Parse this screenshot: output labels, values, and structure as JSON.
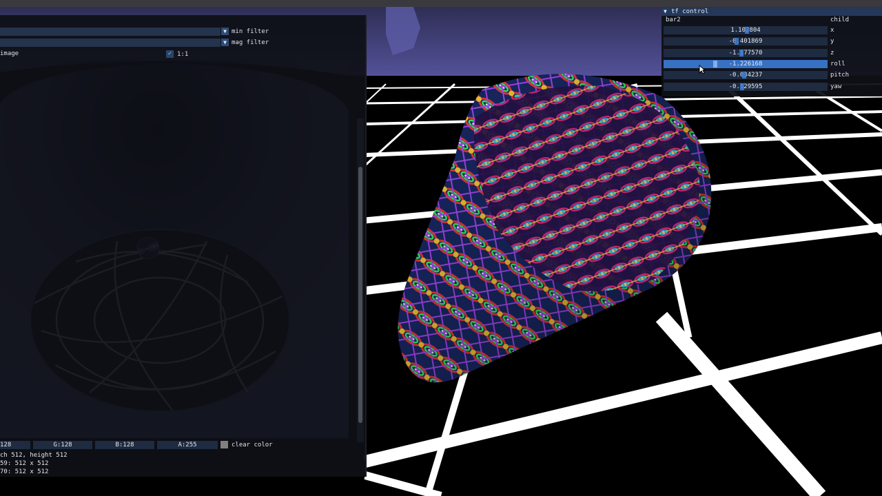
{
  "texture_viewer": {
    "min_filter_label": "min filter",
    "mag_filter_label": "mag filter",
    "image_label": "image",
    "one_to_one_label": "1:1",
    "one_to_one_checked": true,
    "clear_color": {
      "r_text": "128",
      "g_text": "G:128",
      "b_text": "B:128",
      "a_text": "A:255",
      "label": "clear color",
      "swatch": "#808080"
    },
    "info_lines": [
      "ch 512, height 512",
      "59: 512 x 512",
      "70: 512 x 512"
    ]
  },
  "tf_control": {
    "title": "tf control",
    "target": "bar2",
    "target_label": "child",
    "fields": [
      {
        "value": "1.102804",
        "label": "x"
      },
      {
        "value": "-0.401869",
        "label": "y"
      },
      {
        "value": "-1.177570",
        "label": "z"
      },
      {
        "value": "-1.226168",
        "label": "roll",
        "active": true
      },
      {
        "value": "-0.034237",
        "label": "pitch"
      },
      {
        "value": "-0.129595",
        "label": "yaw"
      }
    ]
  },
  "colors": {
    "panel_bg": "#0e1016",
    "accent": "#3771c4",
    "sky": "#3d3c66",
    "grid": "#ffffff"
  },
  "icons": [
    "chevron-down-icon",
    "checkmark-icon",
    "cursor-arrow-icon"
  ]
}
